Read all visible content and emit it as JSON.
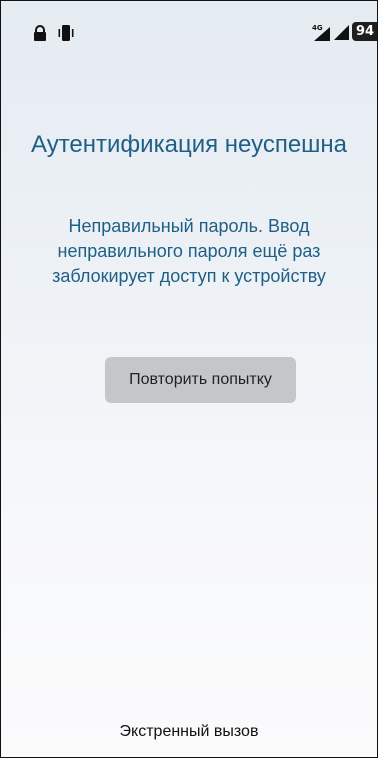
{
  "status_bar": {
    "icons": [
      "lock-icon",
      "vibrate-icon",
      "signal-4g-icon",
      "signal-icon",
      "battery-icon"
    ],
    "network_label": "4G",
    "battery_level": "94"
  },
  "screen": {
    "title": "Аутентификация неуспешна",
    "message": "Неправильный пароль. Ввод неправильного пароля ещё раз заблокирует доступ к устройству",
    "retry_button_label": "Повторить попытку",
    "emergency_call_label": "Экстренный вызов"
  },
  "colors": {
    "accent_text": "#1e5f86",
    "button_bg": "#c4c7ca"
  }
}
